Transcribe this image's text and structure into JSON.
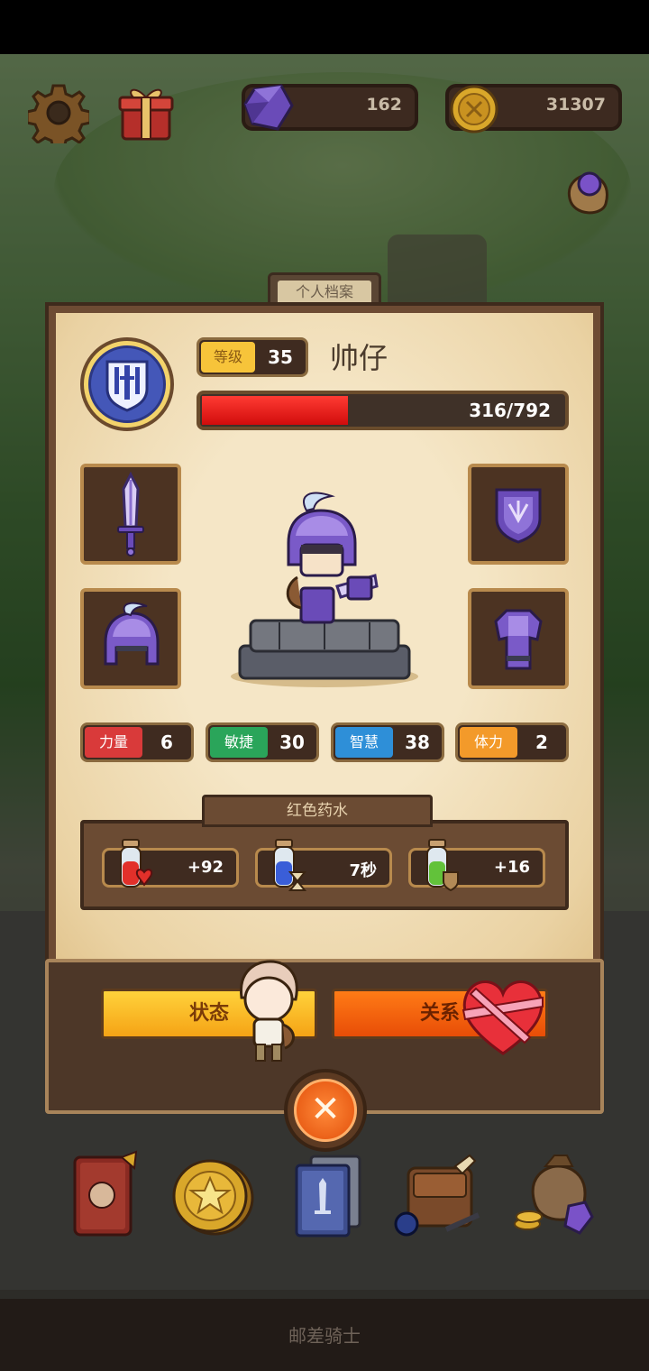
{
  "hud": {
    "gems": "162",
    "coins": "31307"
  },
  "profile": {
    "tab_title": "个人档案",
    "level_label": "等级",
    "level_value": "35",
    "name": "帅仔",
    "hp_text": "316/792",
    "hp_fraction": 0.399
  },
  "stats": [
    {
      "label": "力量",
      "value": "6",
      "color": "#d93a3a"
    },
    {
      "label": "敏捷",
      "value": "30",
      "color": "#2aa55a"
    },
    {
      "label": "智慧",
      "value": "38",
      "color": "#2e8fd8"
    },
    {
      "label": "体力",
      "value": "2",
      "color": "#f39a2a"
    }
  ],
  "potions": {
    "section_title": "红色药水",
    "items": [
      {
        "icon": "red-potion-heart-icon",
        "value": "+92"
      },
      {
        "icon": "blue-potion-hourglass-icon",
        "value": "7秒"
      },
      {
        "icon": "green-potion-shield-icon",
        "value": "+16"
      }
    ]
  },
  "buttons": {
    "status": "状态",
    "relation": "关系"
  },
  "nav": [
    "book-icon",
    "star-coin-icon",
    "card-deck-icon",
    "backpack-icon",
    "treasure-bag-icon"
  ],
  "footer": {
    "title": "邮差骑士"
  }
}
